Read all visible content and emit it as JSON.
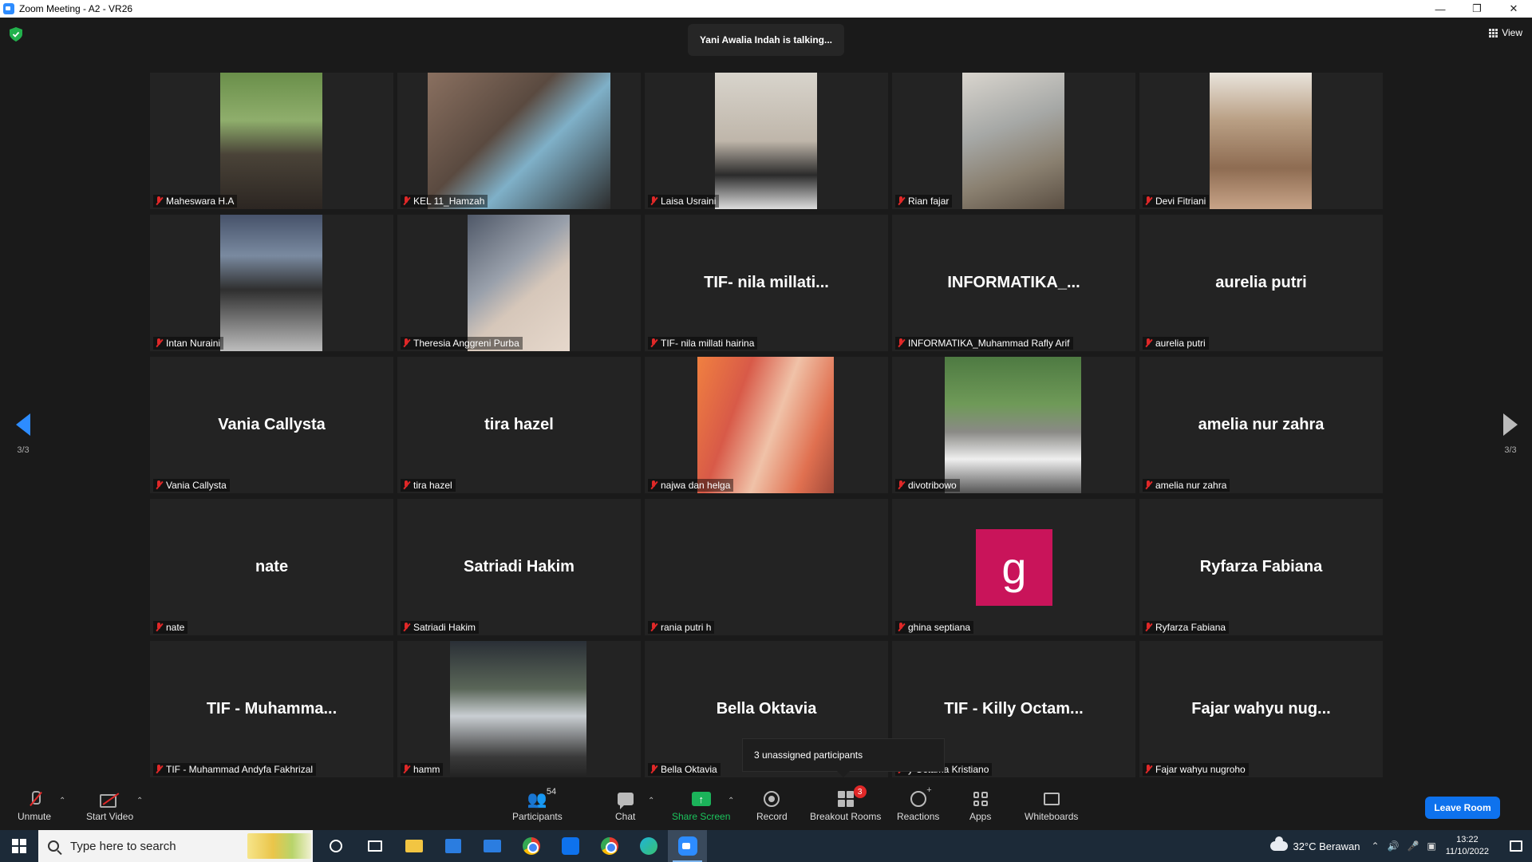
{
  "window": {
    "title": "Zoom Meeting - A2 - VR26"
  },
  "banner": {
    "talking": "Yani Awalia Indah is talking..."
  },
  "view_button": {
    "label": "View"
  },
  "pagination": {
    "left": "3/3",
    "right": "3/3"
  },
  "tiles": [
    {
      "label": "Maheswara H.A",
      "video": "v-green",
      "vleft": 88,
      "vwidth": 128
    },
    {
      "label": "KEL 11_Hamzah",
      "video": "v-roof2",
      "vleft": 38,
      "vwidth": 229
    },
    {
      "label": "Laisa Usraini",
      "video": "v-bright",
      "vleft": 88,
      "vwidth": 128
    },
    {
      "label": "Rian fajar",
      "video": "v-canopy",
      "vleft": 88,
      "vwidth": 128
    },
    {
      "label": "Devi Fitriani",
      "video": "v-hijab",
      "vleft": 88,
      "vwidth": 128
    },
    {
      "label": "Intan Nuraini",
      "video": "v-hall",
      "vleft": 88,
      "vwidth": 128
    },
    {
      "label": "Theresia Anggreni Purba",
      "video": "v-blurry",
      "vleft": 88,
      "vwidth": 128
    },
    {
      "label": "TIF- nila millati hairina",
      "big": "TIF- nila millati..."
    },
    {
      "label": "INFORMATIKA_Muhammad Rafly Arif",
      "big": "INFORMATIKA_..."
    },
    {
      "label": "aurelia putri",
      "big": "aurelia putri"
    },
    {
      "label": "Vania Callysta",
      "big": "Vania Callysta"
    },
    {
      "label": "tira hazel",
      "big": "tira hazel"
    },
    {
      "label": "najwa dan helga",
      "video": "v-selfie",
      "vleft": 66,
      "vwidth": 171
    },
    {
      "label": "divotribowo",
      "video": "v-road",
      "vleft": 66,
      "vwidth": 171
    },
    {
      "label": "amelia nur zahra",
      "big": "amelia nur zahra"
    },
    {
      "label": "nate",
      "big": "nate"
    },
    {
      "label": "Satriadi Hakim",
      "big": "Satriadi Hakim"
    },
    {
      "label": "rania putri h"
    },
    {
      "label": "ghina septiana",
      "avatar": "g"
    },
    {
      "label": "Ryfarza Fabiana",
      "big": "Ryfarza Fabiana"
    },
    {
      "label": "TIF - Muhammad Andyfa Fakhrizal",
      "big": "TIF - Muhamma..."
    },
    {
      "label": "hamm",
      "video": "v-night",
      "vleft": 66,
      "vwidth": 171
    },
    {
      "label": "Bella Oktavia",
      "big": "Bella Oktavia"
    },
    {
      "label": "y Octama Kristiano",
      "big": "TIF - Killy Octam..."
    },
    {
      "label": "Fajar wahyu nugroho",
      "big": "Fajar wahyu nug..."
    }
  ],
  "tooltip": {
    "text": "3 unassigned participants"
  },
  "toolbar": {
    "unmute": "Unmute",
    "start_video": "Start Video",
    "participants": "Participants",
    "participants_count": "54",
    "chat": "Chat",
    "share_screen": "Share Screen",
    "record": "Record",
    "breakout_rooms": "Breakout Rooms",
    "breakout_badge": "3",
    "reactions": "Reactions",
    "apps": "Apps",
    "whiteboards": "Whiteboards",
    "leave_room": "Leave Room"
  },
  "taskbar": {
    "search_placeholder": "Type here to search",
    "weather": "32°C  Berawan",
    "time": "13:22",
    "date": "11/10/2022"
  },
  "colors": {
    "accent": "#0e72ed",
    "share_green": "#1bb35a",
    "muted_red": "#e02828",
    "avatar_magenta": "#c9145a"
  }
}
